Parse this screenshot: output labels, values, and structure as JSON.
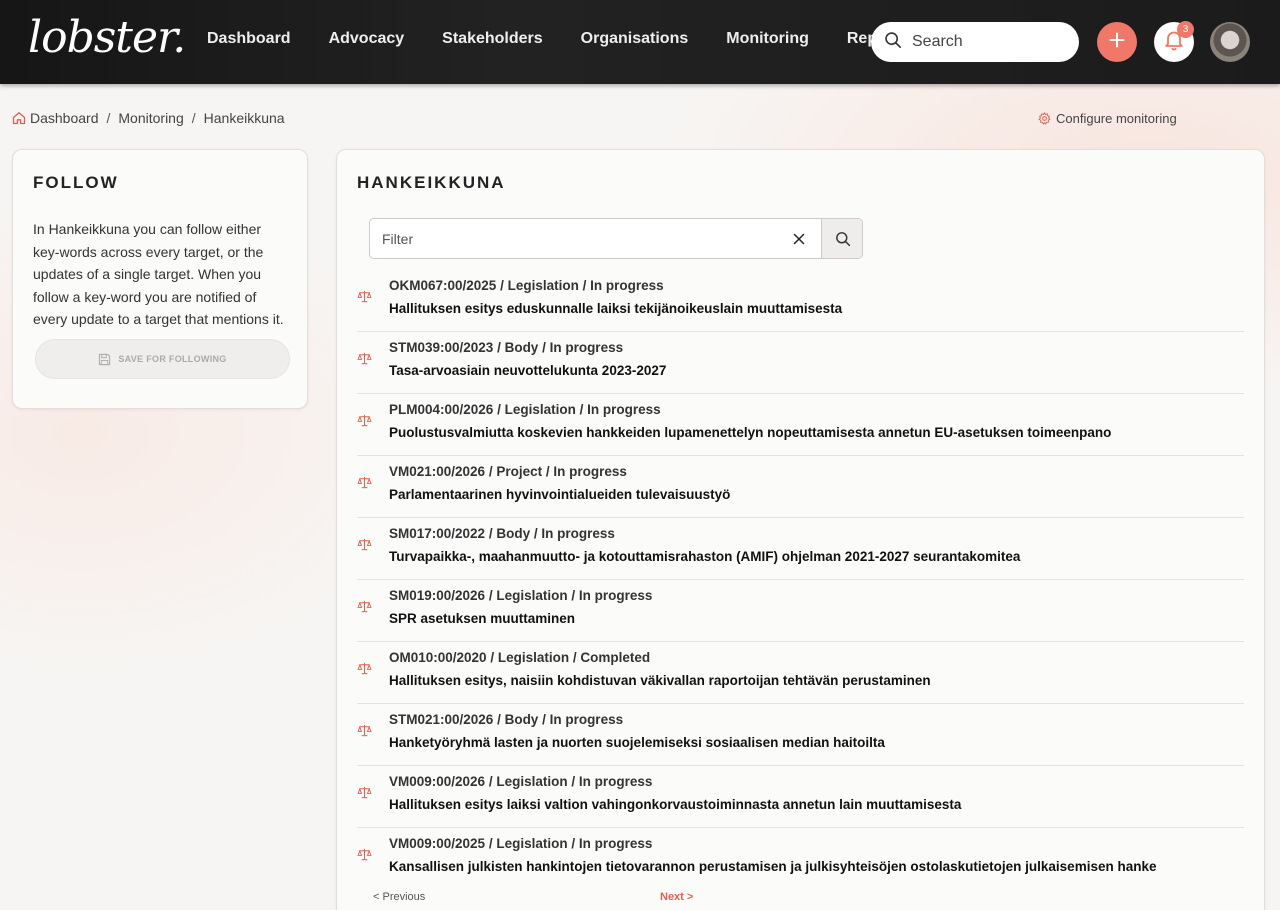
{
  "brand": {
    "logo": "lobster."
  },
  "nav": {
    "items": [
      {
        "label": "Dashboard"
      },
      {
        "label": "Advocacy"
      },
      {
        "label": "Stakeholders"
      },
      {
        "label": "Organisations"
      },
      {
        "label": "Monitoring"
      },
      {
        "label": "Reports"
      }
    ],
    "search_placeholder": "Search",
    "notifications_count": "3",
    "accent_color": "#f07868"
  },
  "breadcrumb": {
    "items": [
      {
        "label": "Dashboard"
      },
      {
        "label": "Monitoring"
      },
      {
        "label": "Hankeikkuna"
      }
    ],
    "separator": "/"
  },
  "configure": {
    "label": "Configure monitoring"
  },
  "follow": {
    "title": "FOLLOW",
    "text": "In Hankeikkuna you can follow either key-words across every target, or the updates of a single target. When you follow a key-word you are notified of every update to a target that mentions it.",
    "save_label": "SAVE FOR FOLLOWING"
  },
  "main": {
    "title": "HANKEIKKUNA",
    "filter_placeholder": "Filter",
    "items": [
      {
        "meta": "OKM067:00/2025 / Legislation / In progress",
        "title": "Hallituksen esitys eduskunnalle laiksi tekijänoikeuslain muuttamisesta"
      },
      {
        "meta": "STM039:00/2023 / Body / In progress",
        "title": "Tasa-arvoasiain neuvottelukunta 2023-2027"
      },
      {
        "meta": "PLM004:00/2026 / Legislation / In progress",
        "title": "Puolustusvalmiutta koskevien hankkeiden lupamenettelyn nopeuttamisesta annetun EU-asetuksen toimeenpano"
      },
      {
        "meta": "VM021:00/2026 / Project / In progress",
        "title": "Parlamentaarinen hyvinvointialueiden tulevaisuustyö"
      },
      {
        "meta": "SM017:00/2022 / Body / In progress",
        "title": "Turvapaikka-, maahanmuutto- ja kotouttamisrahaston (AMIF) ohjelman 2021-2027 seurantakomitea"
      },
      {
        "meta": "SM019:00/2026 / Legislation / In progress",
        "title": "SPR asetuksen muuttaminen"
      },
      {
        "meta": "OM010:00/2020 / Legislation / Completed",
        "title": "Hallituksen esitys, naisiin kohdistuvan väkivallan raportoijan tehtävän perustaminen"
      },
      {
        "meta": "STM021:00/2026 / Body / In progress",
        "title": "Hanketyöryhmä lasten ja nuorten suojelemiseksi sosiaalisen median haitoilta"
      },
      {
        "meta": "VM009:00/2026 / Legislation / In progress",
        "title": "Hallituksen esitys laiksi valtion vahingonkorvaustoiminnasta annetun lain muuttamisesta"
      },
      {
        "meta": "VM009:00/2025 / Legislation / In progress",
        "title": "Kansallisen julkisten hankintojen tietovarannon perustamisen ja julkisyhteisöjen ostolaskutietojen julkaisemisen hanke"
      }
    ],
    "pager": {
      "prev": "< Previous",
      "next": "Next >"
    }
  }
}
